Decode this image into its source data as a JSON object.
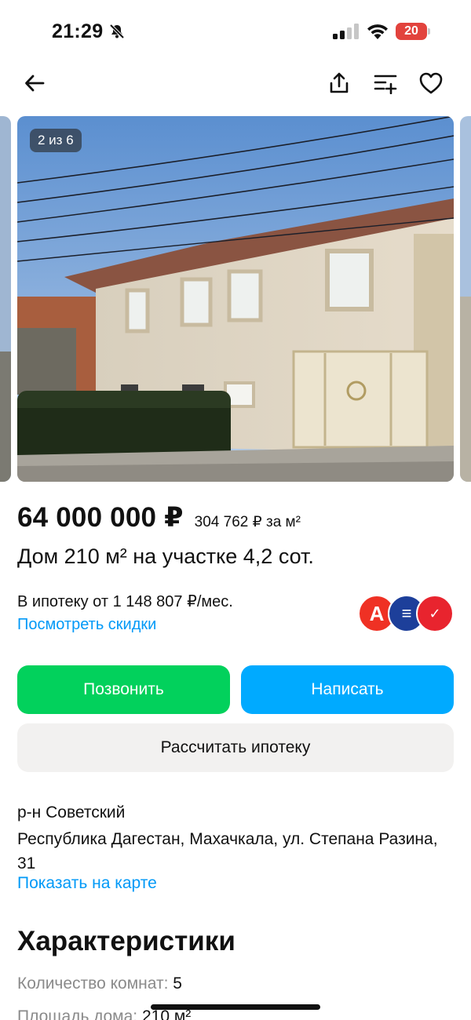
{
  "status_bar": {
    "time": "21:29",
    "battery_level": "20",
    "icons": [
      "bell-slash-icon",
      "cellular-signal-icon",
      "wifi-icon",
      "battery-icon"
    ]
  },
  "nav": {
    "icons": [
      "arrow-left-icon",
      "share-icon",
      "compare-list-icon",
      "heart-icon"
    ]
  },
  "gallery": {
    "counter": "2 из 6"
  },
  "listing": {
    "price": "64 000 000 ₽",
    "price_per_m": "304 762 ₽ за м²",
    "title": "Дом 210 м² на участке 4,2 сот."
  },
  "mortgage": {
    "text": "В ипотеку от 1 148 807 ₽/мес.",
    "discount_link": "Посмотреть скидки",
    "banks": [
      {
        "name": "alfa-bank",
        "glyph": "А",
        "color": "#ef3124"
      },
      {
        "name": "vtb",
        "glyph": "≡",
        "color": "#1d3f9a"
      },
      {
        "name": "psb",
        "glyph": "✓",
        "color": "#e8242e"
      }
    ]
  },
  "actions": {
    "call_label": "Позвонить",
    "write_label": "Написать",
    "calc_label": "Рассчитать ипотеку",
    "call_color": "#02d15c",
    "write_color": "#00aaff"
  },
  "address": {
    "district": "р-н Советский",
    "full": "Республика Дагестан, Махачкала, ул. Степана Разина, 31",
    "map_link": "Показать на карте"
  },
  "characteristics": {
    "title": "Характеристики",
    "rows": [
      {
        "label": "Количество комнат:",
        "value": "5"
      },
      {
        "label": "Площадь дома:",
        "value": "210 м²"
      }
    ]
  }
}
